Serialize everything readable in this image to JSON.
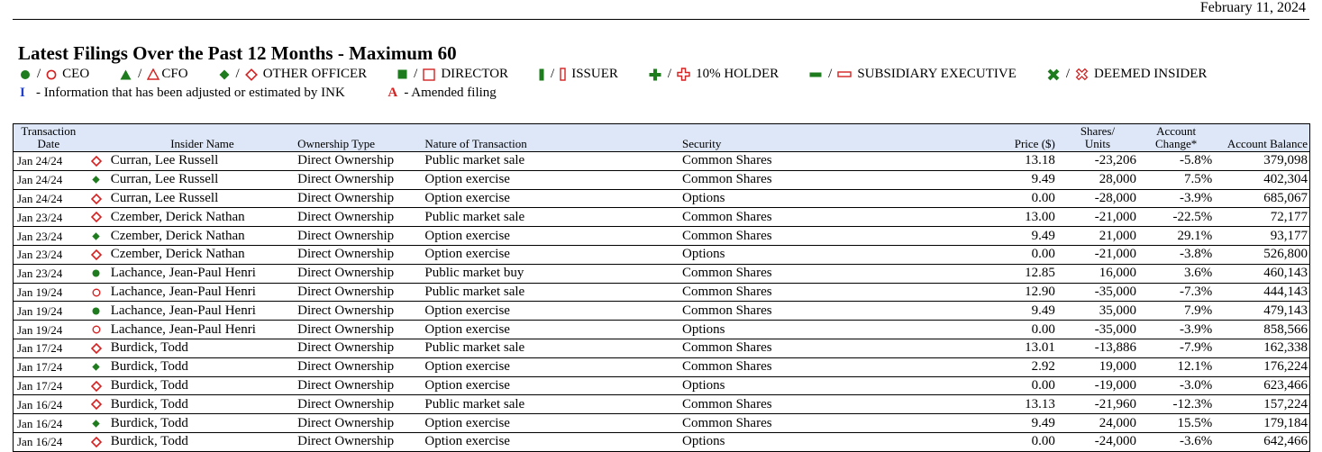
{
  "header": {
    "date": "February 11, 2024",
    "title": "Latest Filings Over the Past 12 Months - Maximum 60"
  },
  "legend": {
    "sep": "/",
    "items": [
      {
        "label": "CEO",
        "icon": "circle"
      },
      {
        "label": "CFO",
        "icon": "triangle"
      },
      {
        "label": "OTHER OFFICER",
        "icon": "diamond"
      },
      {
        "label": "DIRECTOR",
        "icon": "square"
      },
      {
        "label": "ISSUER",
        "icon": "bar"
      },
      {
        "label": "10% HOLDER",
        "icon": "plus"
      },
      {
        "label": "SUBSIDIARY EXECUTIVE",
        "icon": "minus"
      },
      {
        "label": "DEEMED INSIDER",
        "icon": "cross"
      }
    ],
    "colors": {
      "filled": "#1e7b1e",
      "outline": "#d42222",
      "adjusted": "#1f3fd1"
    }
  },
  "notes": {
    "adjusted_marker": "I",
    "adjusted_text": "- Information that has been adjusted or estimated by INK",
    "amended_marker": "A",
    "amended_text": "- Amended filing"
  },
  "table": {
    "headers": {
      "date_1": "Transaction",
      "date_2": "Date",
      "insider": "Insider Name",
      "ownership": "Ownership Type",
      "nature": "Nature of Transaction",
      "security": "Security",
      "price": "Price ($)",
      "shares_1": "Shares/",
      "shares_2": "Units",
      "change_1": "Account",
      "change_2": "Change*",
      "balance": "Account Balance"
    },
    "rows": [
      {
        "date": "Jan 24/24",
        "symbol": "outline-diamond",
        "name": "Curran, Lee Russell",
        "ownership": "Direct Ownership",
        "nature": "Public market sale",
        "security": "Common Shares",
        "price": "13.18",
        "shares": "-23,206",
        "change": "-5.8%",
        "balance": "379,098"
      },
      {
        "date": "Jan 24/24",
        "symbol": "filled-diamond",
        "name": "Curran, Lee Russell",
        "ownership": "Direct Ownership",
        "nature": "Option exercise",
        "security": "Common Shares",
        "price": "9.49",
        "shares": "28,000",
        "change": "7.5%",
        "balance": "402,304"
      },
      {
        "date": "Jan 24/24",
        "symbol": "outline-diamond",
        "name": "Curran, Lee Russell",
        "ownership": "Direct Ownership",
        "nature": "Option exercise",
        "security": "Options",
        "price": "0.00",
        "shares": "-28,000",
        "change": "-3.9%",
        "balance": "685,067"
      },
      {
        "date": "Jan 23/24",
        "symbol": "outline-diamond",
        "name": "Czember, Derick Nathan",
        "ownership": "Direct Ownership",
        "nature": "Public market sale",
        "security": "Common Shares",
        "price": "13.00",
        "shares": "-21,000",
        "change": "-22.5%",
        "balance": "72,177"
      },
      {
        "date": "Jan 23/24",
        "symbol": "filled-diamond",
        "name": "Czember, Derick Nathan",
        "ownership": "Direct Ownership",
        "nature": "Option exercise",
        "security": "Common Shares",
        "price": "9.49",
        "shares": "21,000",
        "change": "29.1%",
        "balance": "93,177"
      },
      {
        "date": "Jan 23/24",
        "symbol": "outline-diamond",
        "name": "Czember, Derick Nathan",
        "ownership": "Direct Ownership",
        "nature": "Option exercise",
        "security": "Options",
        "price": "0.00",
        "shares": "-21,000",
        "change": "-3.8%",
        "balance": "526,800"
      },
      {
        "date": "Jan 23/24",
        "symbol": "filled-circle",
        "name": "Lachance, Jean-Paul Henri",
        "ownership": "Direct Ownership",
        "nature": "Public market buy",
        "security": "Common Shares",
        "price": "12.85",
        "shares": "16,000",
        "change": "3.6%",
        "balance": "460,143"
      },
      {
        "date": "Jan 19/24",
        "symbol": "outline-circle",
        "name": "Lachance, Jean-Paul Henri",
        "ownership": "Direct Ownership",
        "nature": "Public market sale",
        "security": "Common Shares",
        "price": "12.90",
        "shares": "-35,000",
        "change": "-7.3%",
        "balance": "444,143"
      },
      {
        "date": "Jan 19/24",
        "symbol": "filled-circle",
        "name": "Lachance, Jean-Paul Henri",
        "ownership": "Direct Ownership",
        "nature": "Option exercise",
        "security": "Common Shares",
        "price": "9.49",
        "shares": "35,000",
        "change": "7.9%",
        "balance": "479,143"
      },
      {
        "date": "Jan 19/24",
        "symbol": "outline-circle",
        "name": "Lachance, Jean-Paul Henri",
        "ownership": "Direct Ownership",
        "nature": "Option exercise",
        "security": "Options",
        "price": "0.00",
        "shares": "-35,000",
        "change": "-3.9%",
        "balance": "858,566"
      },
      {
        "date": "Jan 17/24",
        "symbol": "outline-diamond",
        "name": "Burdick, Todd",
        "ownership": "Direct Ownership",
        "nature": "Public market sale",
        "security": "Common Shares",
        "price": "13.01",
        "shares": "-13,886",
        "change": "-7.9%",
        "balance": "162,338"
      },
      {
        "date": "Jan 17/24",
        "symbol": "filled-diamond",
        "name": "Burdick, Todd",
        "ownership": "Direct Ownership",
        "nature": "Option exercise",
        "security": "Common Shares",
        "price": "2.92",
        "shares": "19,000",
        "change": "12.1%",
        "balance": "176,224"
      },
      {
        "date": "Jan 17/24",
        "symbol": "outline-diamond",
        "name": "Burdick, Todd",
        "ownership": "Direct Ownership",
        "nature": "Option exercise",
        "security": "Options",
        "price": "0.00",
        "shares": "-19,000",
        "change": "-3.0%",
        "balance": "623,466"
      },
      {
        "date": "Jan 16/24",
        "symbol": "outline-diamond",
        "name": "Burdick, Todd",
        "ownership": "Direct Ownership",
        "nature": "Public market sale",
        "security": "Common Shares",
        "price": "13.13",
        "shares": "-21,960",
        "change": "-12.3%",
        "balance": "157,224"
      },
      {
        "date": "Jan 16/24",
        "symbol": "filled-diamond",
        "name": "Burdick, Todd",
        "ownership": "Direct Ownership",
        "nature": "Option exercise",
        "security": "Common Shares",
        "price": "9.49",
        "shares": "24,000",
        "change": "15.5%",
        "balance": "179,184"
      },
      {
        "date": "Jan 16/24",
        "symbol": "outline-diamond",
        "name": "Burdick, Todd",
        "ownership": "Direct Ownership",
        "nature": "Option exercise",
        "security": "Options",
        "price": "0.00",
        "shares": "-24,000",
        "change": "-3.6%",
        "balance": "642,466"
      }
    ]
  }
}
